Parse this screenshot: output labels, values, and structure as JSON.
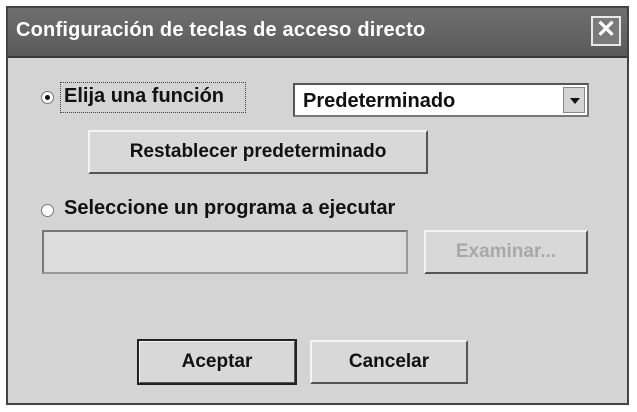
{
  "dialog": {
    "title": "Configuración de teclas de acceso directo",
    "close_icon": "close-icon",
    "close_glyph": "✕"
  },
  "function_option": {
    "label": "Elija una función",
    "checked": true
  },
  "function_select": {
    "value": "Predeterminado"
  },
  "reset_button": {
    "label": "Restablecer predeterminado"
  },
  "program_option": {
    "label": "Seleccione un programa a ejecutar",
    "checked": false
  },
  "program_path": {
    "value": ""
  },
  "browse_button": {
    "label": "Examinar...",
    "disabled": true
  },
  "footer": {
    "accept_label": "Aceptar",
    "cancel_label": "Cancelar"
  }
}
